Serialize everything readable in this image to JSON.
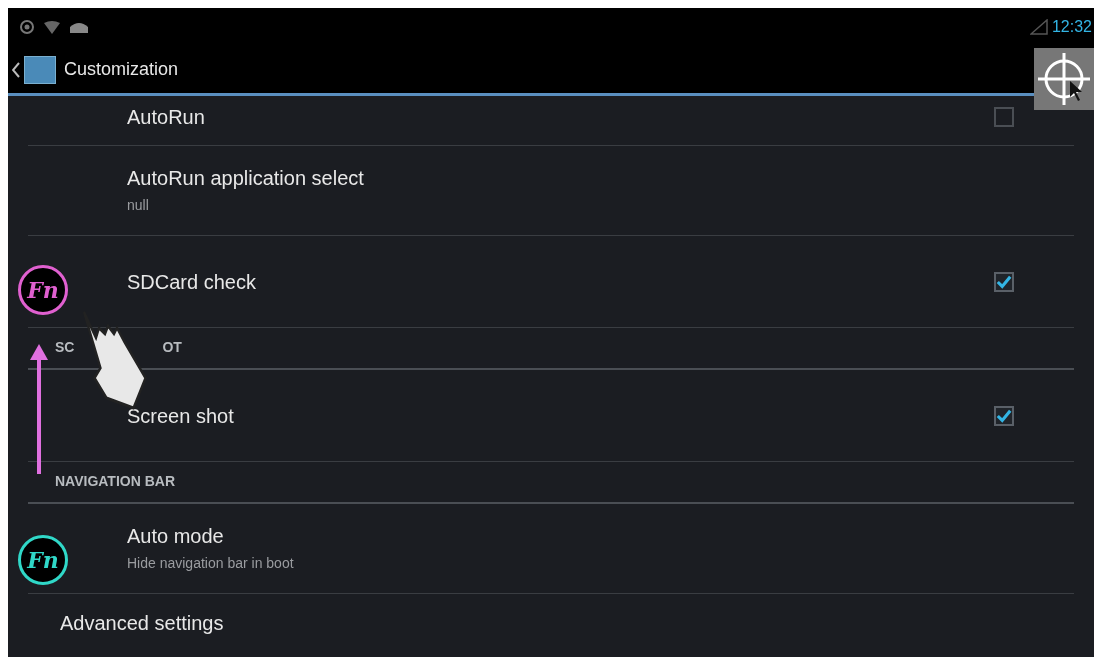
{
  "status_bar": {
    "time": "12:32"
  },
  "action_bar": {
    "title": "Customization"
  },
  "list": [
    {
      "kind": "toggle",
      "title": "AutoRun",
      "checked": false
    },
    {
      "kind": "item",
      "title": "AutoRun application select",
      "summary": "null"
    },
    {
      "kind": "toggle",
      "title": "SDCard check",
      "checked": true
    },
    {
      "kind": "header",
      "parts": [
        "SC",
        "OT"
      ]
    },
    {
      "kind": "toggle",
      "title": "Screen shot",
      "checked": true
    },
    {
      "kind": "header",
      "parts": [
        "NAVIGATION BAR"
      ]
    },
    {
      "kind": "item",
      "title": "Auto mode",
      "summary": "Hide navigation bar in boot"
    },
    {
      "kind": "plain",
      "title": "Advanced settings"
    }
  ],
  "badges": [
    {
      "label": "Fn",
      "color": "#e060d0"
    },
    {
      "label": "Fn",
      "color": "#30d8c8"
    }
  ]
}
